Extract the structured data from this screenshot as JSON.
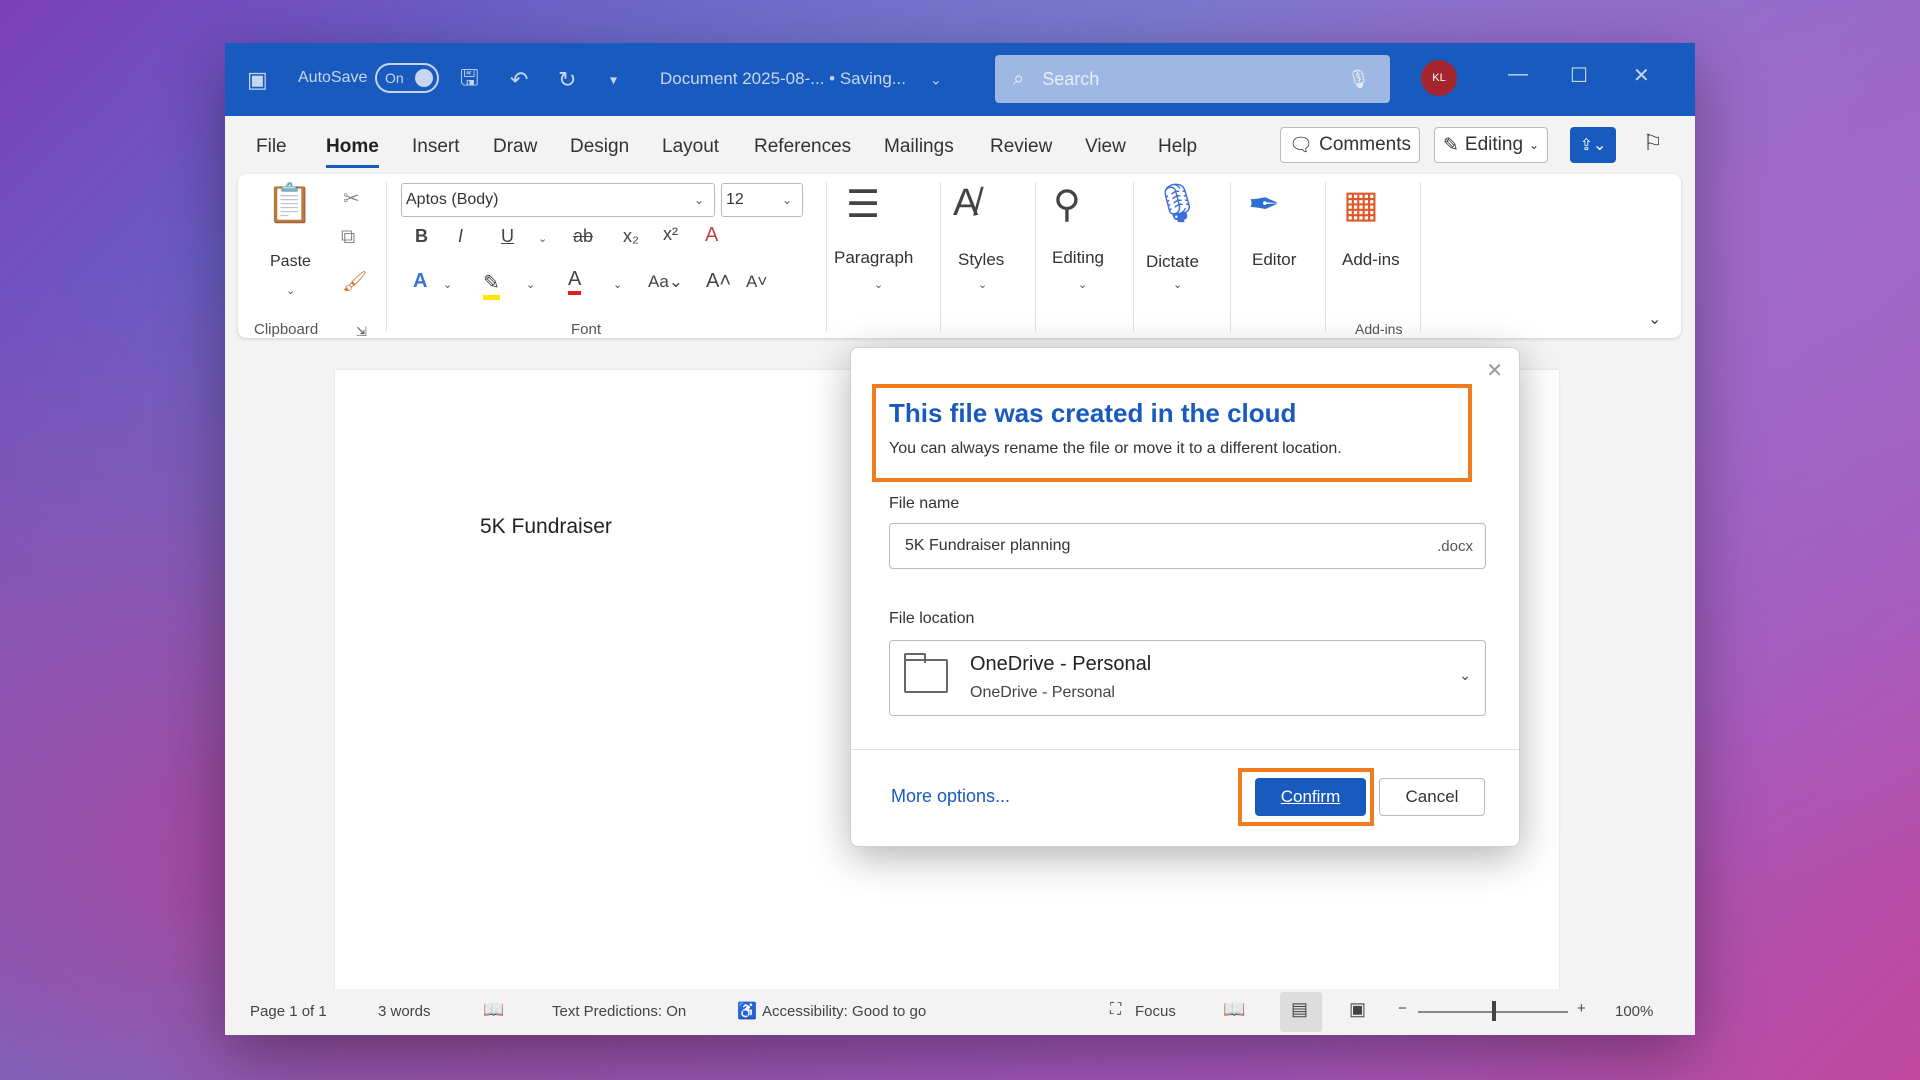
{
  "titlebar": {
    "autosave_label": "AutoSave",
    "toggle_state": "On",
    "document_title": "Document 2025-08-... • Saving...",
    "search_placeholder": "Search",
    "avatar_initials": "KL",
    "accent_color": "#185abd"
  },
  "menu": {
    "items": [
      "File",
      "Home",
      "Insert",
      "Draw",
      "Design",
      "Layout",
      "References",
      "Mailings",
      "Review",
      "View",
      "Help"
    ],
    "active": "Home",
    "comments_label": "Comments",
    "editing_label": "Editing"
  },
  "ribbon": {
    "paste_label": "Paste",
    "clipboard_label": "Clipboard",
    "font_name": "Aptos (Body)",
    "font_size": "12",
    "font_label": "Font",
    "paragraph_label": "Paragraph",
    "styles_label": "Styles",
    "editing_label": "Editing",
    "dictate_label": "Dictate",
    "editor_label": "Editor",
    "addins_label": "Add-ins",
    "addins_group_label": "Add-ins"
  },
  "document": {
    "body_text": "5K Fundraiser"
  },
  "dialog": {
    "title": "This file was created in the cloud",
    "subtitle": "You can always rename the file or move it to a different location.",
    "file_name_label": "File name",
    "file_name_value": "5K Fundraiser planning",
    "file_extension": ".docx",
    "file_location_label": "File location",
    "location_main": "OneDrive - Personal",
    "location_sub": "OneDrive - Personal",
    "more_options": "More options...",
    "confirm_label": "Confirm",
    "cancel_label": "Cancel",
    "highlight_color": "#f07c1e"
  },
  "status": {
    "page": "Page 1 of 1",
    "words": "3 words",
    "text_predictions": "Text Predictions: On",
    "accessibility": "Accessibility: Good to go",
    "focus": "Focus",
    "zoom": "100%"
  }
}
